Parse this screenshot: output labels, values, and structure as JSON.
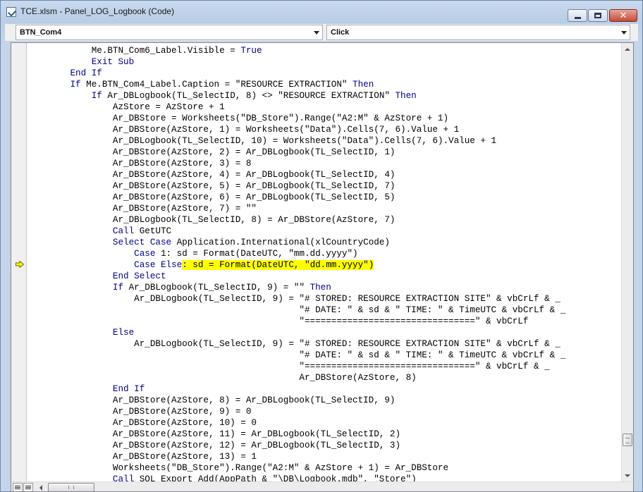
{
  "window": {
    "title": "TCE.xlsm - Panel_LOG_Logbook (Code)"
  },
  "object_dropdown": {
    "value": "BTN_Com4"
  },
  "procedure_dropdown": {
    "value": "Click"
  },
  "code_lines": [
    {
      "segs": [
        {
          "t": "            Me.BTN_Com6_Label.Visible = "
        },
        {
          "t": "True",
          "k": 1
        }
      ]
    },
    {
      "segs": [
        {
          "t": "            "
        },
        {
          "t": "Exit Sub",
          "k": 1
        }
      ]
    },
    {
      "segs": [
        {
          "t": "        "
        },
        {
          "t": "End If",
          "k": 1
        }
      ]
    },
    {
      "segs": [
        {
          "t": "        "
        },
        {
          "t": "If",
          "k": 1
        },
        {
          "t": " Me.BTN_Com4_Label.Caption = \"RESOURCE EXTRACTION\" "
        },
        {
          "t": "Then",
          "k": 1
        }
      ]
    },
    {
      "segs": [
        {
          "t": "            "
        },
        {
          "t": "If",
          "k": 1
        },
        {
          "t": " Ar_DBLogbook(TL_SelectID, 8) <> \"RESOURCE EXTRACTION\" "
        },
        {
          "t": "Then",
          "k": 1
        }
      ]
    },
    {
      "segs": [
        {
          "t": "                AzStore = AzStore + 1"
        }
      ]
    },
    {
      "segs": [
        {
          "t": "                Ar_DBStore = Worksheets(\"DB_Store\").Range(\"A2:M\" & AzStore + 1)"
        }
      ]
    },
    {
      "segs": [
        {
          "t": "                Ar_DBStore(AzStore, 1) = Worksheets(\"Data\").Cells(7, 6).Value + 1"
        }
      ]
    },
    {
      "segs": [
        {
          "t": "                Ar_DBLogbook(TL_SelectID, 10) = Worksheets(\"Data\").Cells(7, 6).Value + 1"
        }
      ]
    },
    {
      "segs": [
        {
          "t": "                Ar_DBStore(AzStore, 2) = Ar_DBLogbook(TL_SelectID, 1)"
        }
      ]
    },
    {
      "segs": [
        {
          "t": "                Ar_DBStore(AzStore, 3) = 8"
        }
      ]
    },
    {
      "segs": [
        {
          "t": "                Ar_DBStore(AzStore, 4) = Ar_DBLogbook(TL_SelectID, 4)"
        }
      ]
    },
    {
      "segs": [
        {
          "t": "                Ar_DBStore(AzStore, 5) = Ar_DBLogbook(TL_SelectID, 7)"
        }
      ]
    },
    {
      "segs": [
        {
          "t": "                Ar_DBStore(AzStore, 6) = Ar_DBLogbook(TL_SelectID, 5)"
        }
      ]
    },
    {
      "segs": [
        {
          "t": "                Ar_DBStore(AzStore, 7) = \"\""
        }
      ]
    },
    {
      "segs": [
        {
          "t": "                Ar_DBLogbook(TL_SelectID, 8) = Ar_DBStore(AzStore, 7)"
        }
      ]
    },
    {
      "segs": [
        {
          "t": "                "
        },
        {
          "t": "Call",
          "k": 1
        },
        {
          "t": " GetUTC"
        }
      ]
    },
    {
      "segs": [
        {
          "t": "                "
        },
        {
          "t": "Select Case",
          "k": 1
        },
        {
          "t": " Application.International(xlCountryCode)"
        }
      ]
    },
    {
      "segs": [
        {
          "t": "                    "
        },
        {
          "t": "Case",
          "k": 1
        },
        {
          "t": " 1: sd = Format(DateUTC, \"mm.dd.yyyy\")"
        }
      ]
    },
    {
      "segs": [
        {
          "t": "                    "
        },
        {
          "t": "Case Else",
          "k": 1
        },
        {
          "t": ": sd = Format(DateUTC, \"dd.mm.yyyy\")",
          "h": 1
        }
      ]
    },
    {
      "segs": [
        {
          "t": "                "
        },
        {
          "t": "End Select",
          "k": 1
        }
      ]
    },
    {
      "segs": [
        {
          "t": "                "
        },
        {
          "t": "If",
          "k": 1
        },
        {
          "t": " Ar_DBLogbook(TL_SelectID, 9) = \"\" "
        },
        {
          "t": "Then",
          "k": 1
        }
      ]
    },
    {
      "segs": [
        {
          "t": "                    Ar_DBLogbook(TL_SelectID, 9) = \"# STORED: RESOURCE EXTRACTION SITE\" & vbCrLf & _"
        }
      ]
    },
    {
      "segs": [
        {
          "t": "                                                   \"# DATE: \" & sd & \" TIME: \" & TimeUTC & vbCrLf & _"
        }
      ]
    },
    {
      "segs": [
        {
          "t": "                                                   \"================================\" & vbCrLf"
        }
      ]
    },
    {
      "segs": [
        {
          "t": "                "
        },
        {
          "t": "Else",
          "k": 1
        }
      ]
    },
    {
      "segs": [
        {
          "t": "                    Ar_DBLogbook(TL_SelectID, 9) = \"# STORED: RESOURCE EXTRACTION SITE\" & vbCrLf & _"
        }
      ]
    },
    {
      "segs": [
        {
          "t": "                                                   \"# DATE: \" & sd & \" TIME: \" & TimeUTC & vbCrLf & _"
        }
      ]
    },
    {
      "segs": [
        {
          "t": "                                                   \"================================\" & vbCrLf & _"
        }
      ]
    },
    {
      "segs": [
        {
          "t": "                                                   Ar_DBStore(AzStore, 8)"
        }
      ]
    },
    {
      "segs": [
        {
          "t": "                "
        },
        {
          "t": "End If",
          "k": 1
        }
      ]
    },
    {
      "segs": [
        {
          "t": "                Ar_DBStore(AzStore, 8) = Ar_DBLogbook(TL_SelectID, 9)"
        }
      ]
    },
    {
      "segs": [
        {
          "t": "                Ar_DBStore(AzStore, 9) = 0"
        }
      ]
    },
    {
      "segs": [
        {
          "t": "                Ar_DBStore(AzStore, 10) = 0"
        }
      ]
    },
    {
      "segs": [
        {
          "t": "                Ar_DBStore(AzStore, 11) = Ar_DBLogbook(TL_SelectID, 2)"
        }
      ]
    },
    {
      "segs": [
        {
          "t": "                Ar_DBStore(AzStore, 12) = Ar_DBLogbook(TL_SelectID, 3)"
        }
      ]
    },
    {
      "segs": [
        {
          "t": "                Ar_DBStore(AzStore, 13) = 1"
        }
      ]
    },
    {
      "segs": [
        {
          "t": "                Worksheets(\"DB_Store\").Range(\"A2:M\" & AzStore + 1) = Ar_DBStore"
        }
      ]
    },
    {
      "segs": [
        {
          "t": "                "
        },
        {
          "t": "Call",
          "k": 1
        },
        {
          "t": " SQL_Export_Add(AppPath & \"\\DB\\Logbook.mdb\", \"Store\")"
        }
      ]
    }
  ],
  "execution_line": 20,
  "colors": {
    "keyword": "#00008b",
    "highlight": "#ffff00",
    "execution_arrow": "#ffff00"
  },
  "icons": {
    "app": "vba-editor-icon",
    "execution": "execution-pointer-arrow-icon"
  }
}
